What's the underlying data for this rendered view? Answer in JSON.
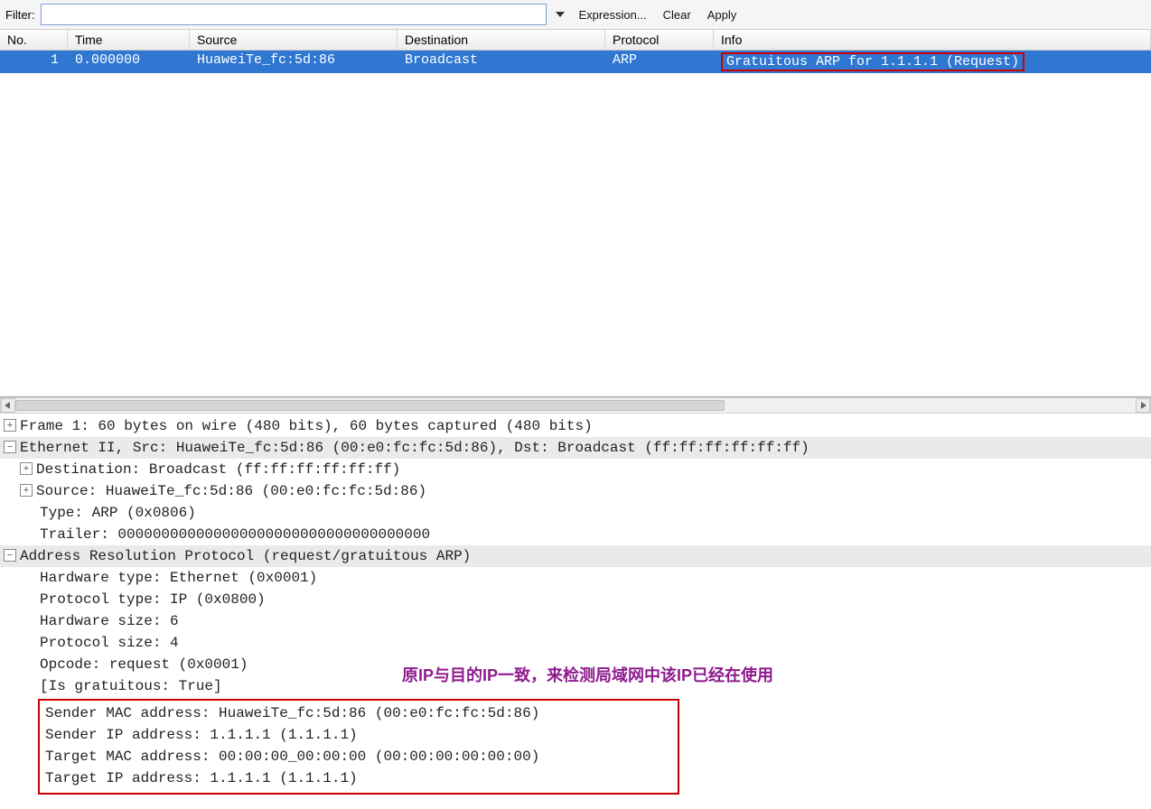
{
  "filter": {
    "label": "Filter:",
    "value": "",
    "expression": "Expression...",
    "clear": "Clear",
    "apply": "Apply"
  },
  "columns": {
    "no": "No.",
    "time": "Time",
    "source": "Source",
    "destination": "Destination",
    "protocol": "Protocol",
    "info": "Info"
  },
  "row": {
    "no": "1",
    "time": "0.000000",
    "source": "HuaweiTe_fc:5d:86",
    "destination": "Broadcast",
    "protocol": "ARP",
    "info": "Gratuitous ARP for 1.1.1.1 (Request)"
  },
  "details": {
    "frame": "Frame 1: 60 bytes on wire (480 bits), 60 bytes captured (480 bits)",
    "eth": "Ethernet II, Src: HuaweiTe_fc:5d:86 (00:e0:fc:fc:5d:86), Dst: Broadcast (ff:ff:ff:ff:ff:ff)",
    "eth_dst": "Destination: Broadcast (ff:ff:ff:ff:ff:ff)",
    "eth_src": "Source: HuaweiTe_fc:5d:86 (00:e0:fc:fc:5d:86)",
    "eth_type": "Type: ARP (0x0806)",
    "eth_trailer": "Trailer: 000000000000000000000000000000000000",
    "arp": "Address Resolution Protocol (request/gratuitous ARP)",
    "arp_hwtype": "Hardware type: Ethernet (0x0001)",
    "arp_ptype": "Protocol type: IP (0x0800)",
    "arp_hwsize": "Hardware size: 6",
    "arp_psize": "Protocol size: 4",
    "arp_opcode": "Opcode: request (0x0001)",
    "arp_isgrat": "[Is gratuitous: True]",
    "arp_sender_mac": "Sender MAC address: HuaweiTe_fc:5d:86 (00:e0:fc:fc:5d:86)",
    "arp_sender_ip": "Sender IP address: 1.1.1.1 (1.1.1.1)",
    "arp_target_mac": "Target MAC address: 00:00:00_00:00:00 (00:00:00:00:00:00)",
    "arp_target_ip": "Target IP address: 1.1.1.1 (1.1.1.1)"
  },
  "annotation": "原IP与目的IP一致，来检测局域网中该IP已经在使用"
}
